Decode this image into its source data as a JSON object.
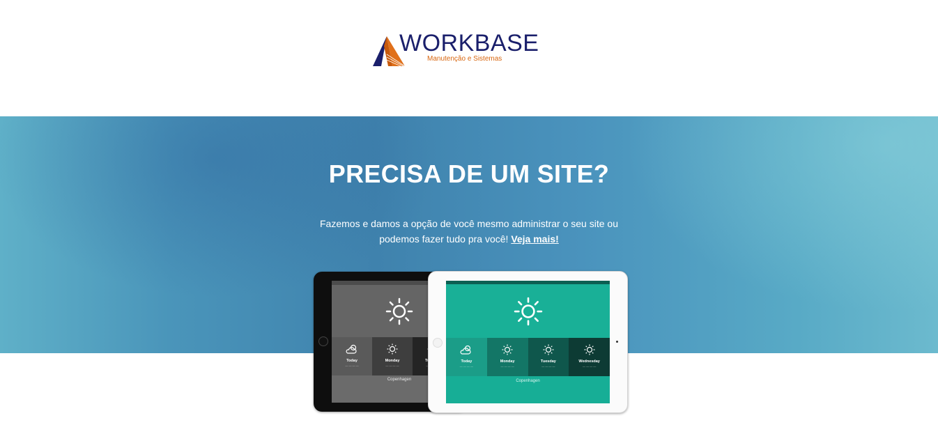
{
  "brand": {
    "name": "WORKBASE",
    "tagline": "Manutenção e Sistemas",
    "colors": {
      "navy": "#1a1f6b",
      "orange": "#d8660f"
    }
  },
  "hero": {
    "title": "PRECISA DE UM SITE?",
    "text_line1": "Fazemos e damos a opção de você mesmo administrar o seu site ou",
    "text_line2": "podemos fazer tudo pra você!",
    "link_label": "Veja mais!"
  },
  "tablets": {
    "left": {
      "color": "#0e0e0e",
      "screen_color": "#6b6b6b",
      "days": [
        {
          "name": "Today",
          "icon": "cloud-sun-icon"
        },
        {
          "name": "Monday",
          "icon": "sun-icon"
        },
        {
          "name": "Tuesday",
          "icon": "sun-icon"
        }
      ],
      "city": "Copenhagen"
    },
    "right": {
      "color": "#fbfbfb",
      "screen_color": "#17ae96",
      "days": [
        {
          "name": "Today",
          "icon": "cloud-sun-icon"
        },
        {
          "name": "Monday",
          "icon": "sun-icon"
        },
        {
          "name": "Tuesday",
          "icon": "sun-icon"
        },
        {
          "name": "Wednesday",
          "icon": "sun-icon"
        }
      ],
      "city": "Copenhagen"
    }
  }
}
